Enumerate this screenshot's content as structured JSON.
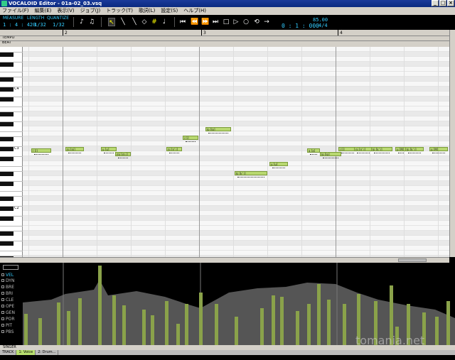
{
  "window": {
    "title": "VOCALOID Editor - 01a-02_03.vsq"
  },
  "menu": [
    "ファイル(F)",
    "編集(E)",
    "表示(V)",
    "ジョブ(J)",
    "トラック(T)",
    "歌詞(L)",
    "設定(S)",
    "ヘルプ(H)"
  ],
  "toolbar": {
    "measure_label": "MEASURE",
    "length_label": "LENGTH",
    "quantize_label": "QUANTIZE",
    "measure_value": "1 : 4 : 420",
    "length_value": "1/32",
    "quantize_value": "1/32",
    "time_display": "0 : 1 : 000",
    "tempo": "85.00",
    "beat": "4/4"
  },
  "ruler": {
    "tempo_label": "TEMPO",
    "beat_label": "BEAT",
    "measures": [
      "2",
      "3",
      "4"
    ]
  },
  "piano": {
    "octaves": [
      "C4",
      "C3",
      "C2"
    ]
  },
  "notes": [
    {
      "lyric": "| [i]"
    },
    {
      "lyric": "ni [ni]"
    },
    {
      "lyric": "u [u]"
    },
    {
      "lyric": "mi [m i]"
    },
    {
      "lyric": "ni [n' i]"
    },
    {
      "lyric": "i [i]"
    },
    {
      "lyric": "lo [lo]"
    },
    {
      "lyric": "ki [k' i]"
    },
    {
      "lyric": "u [u]"
    },
    {
      "lyric": "a [a]"
    },
    {
      "lyric": "lo [lo]"
    },
    {
      "lyric": "i [i]"
    },
    {
      "lyric": "ni [n' i]"
    },
    {
      "lyric": "ki [k' i]"
    },
    {
      "lyric": "u [M]"
    },
    {
      "lyric": "ki [k' i]"
    },
    {
      "lyric": "u [M]"
    }
  ],
  "controls": [
    "VEL",
    "DYN",
    "BRE",
    "BRI",
    "CLE",
    "OPE",
    "GEN",
    "POR",
    "PIT",
    "PBS"
  ],
  "control_active": "VEL",
  "singer_label": "SINGER",
  "track_label": "TRACK",
  "tracks": [
    "1: Voice",
    "2: Drum..."
  ],
  "render_all": "RENDER ALL",
  "watermark": "tomania.net"
}
